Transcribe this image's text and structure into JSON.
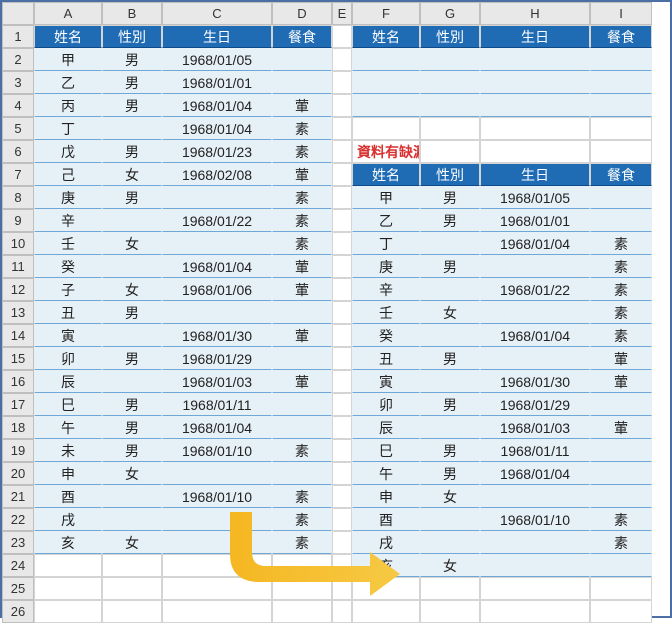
{
  "columns": [
    "A",
    "B",
    "C",
    "D",
    "E",
    "F",
    "G",
    "H",
    "I"
  ],
  "row_count": 26,
  "headers": [
    "姓名",
    "性別",
    "生日",
    "餐食"
  ],
  "note_text": "資料有缺漏者",
  "left_table": [
    {
      "name": "甲",
      "sex": "男",
      "birth": "1968/01/05",
      "meal": ""
    },
    {
      "name": "乙",
      "sex": "男",
      "birth": "1968/01/01",
      "meal": ""
    },
    {
      "name": "丙",
      "sex": "男",
      "birth": "1968/01/04",
      "meal": "葷"
    },
    {
      "name": "丁",
      "sex": "",
      "birth": "1968/01/04",
      "meal": "素"
    },
    {
      "name": "戊",
      "sex": "男",
      "birth": "1968/01/23",
      "meal": "素"
    },
    {
      "name": "己",
      "sex": "女",
      "birth": "1968/02/08",
      "meal": "葷"
    },
    {
      "name": "庚",
      "sex": "男",
      "birth": "",
      "meal": "素"
    },
    {
      "name": "辛",
      "sex": "",
      "birth": "1968/01/22",
      "meal": "素"
    },
    {
      "name": "壬",
      "sex": "女",
      "birth": "",
      "meal": "素"
    },
    {
      "name": "癸",
      "sex": "",
      "birth": "1968/01/04",
      "meal": "葷"
    },
    {
      "name": "子",
      "sex": "女",
      "birth": "1968/01/06",
      "meal": "葷"
    },
    {
      "name": "丑",
      "sex": "男",
      "birth": "",
      "meal": ""
    },
    {
      "name": "寅",
      "sex": "",
      "birth": "1968/01/30",
      "meal": "葷"
    },
    {
      "name": "卯",
      "sex": "男",
      "birth": "1968/01/29",
      "meal": ""
    },
    {
      "name": "辰",
      "sex": "",
      "birth": "1968/01/03",
      "meal": "葷"
    },
    {
      "name": "巳",
      "sex": "男",
      "birth": "1968/01/11",
      "meal": ""
    },
    {
      "name": "午",
      "sex": "男",
      "birth": "1968/01/04",
      "meal": ""
    },
    {
      "name": "未",
      "sex": "男",
      "birth": "1968/01/10",
      "meal": "素"
    },
    {
      "name": "申",
      "sex": "女",
      "birth": "",
      "meal": ""
    },
    {
      "name": "酉",
      "sex": "",
      "birth": "1968/01/10",
      "meal": "素"
    },
    {
      "name": "戌",
      "sex": "",
      "birth": "",
      "meal": "素"
    },
    {
      "name": "亥",
      "sex": "女",
      "birth": "",
      "meal": "素"
    }
  ],
  "right_table": [
    {
      "name": "甲",
      "sex": "男",
      "birth": "1968/01/05",
      "meal": ""
    },
    {
      "name": "乙",
      "sex": "男",
      "birth": "1968/01/01",
      "meal": ""
    },
    {
      "name": "丁",
      "sex": "",
      "birth": "1968/01/04",
      "meal": "素"
    },
    {
      "name": "庚",
      "sex": "男",
      "birth": "",
      "meal": "素"
    },
    {
      "name": "辛",
      "sex": "",
      "birth": "1968/01/22",
      "meal": "素"
    },
    {
      "name": "壬",
      "sex": "女",
      "birth": "",
      "meal": "素"
    },
    {
      "name": "癸",
      "sex": "",
      "birth": "1968/01/04",
      "meal": "素"
    },
    {
      "name": "丑",
      "sex": "男",
      "birth": "",
      "meal": "葷"
    },
    {
      "name": "寅",
      "sex": "",
      "birth": "1968/01/30",
      "meal": "葷"
    },
    {
      "name": "卯",
      "sex": "男",
      "birth": "1968/01/29",
      "meal": ""
    },
    {
      "name": "辰",
      "sex": "",
      "birth": "1968/01/03",
      "meal": "葷"
    },
    {
      "name": "巳",
      "sex": "男",
      "birth": "1968/01/11",
      "meal": ""
    },
    {
      "name": "午",
      "sex": "男",
      "birth": "1968/01/04",
      "meal": ""
    },
    {
      "name": "申",
      "sex": "女",
      "birth": "",
      "meal": ""
    },
    {
      "name": "酉",
      "sex": "",
      "birth": "1968/01/10",
      "meal": "素"
    },
    {
      "name": "戌",
      "sex": "",
      "birth": "",
      "meal": "素"
    },
    {
      "name": "亥",
      "sex": "女",
      "birth": "",
      "meal": ""
    }
  ]
}
